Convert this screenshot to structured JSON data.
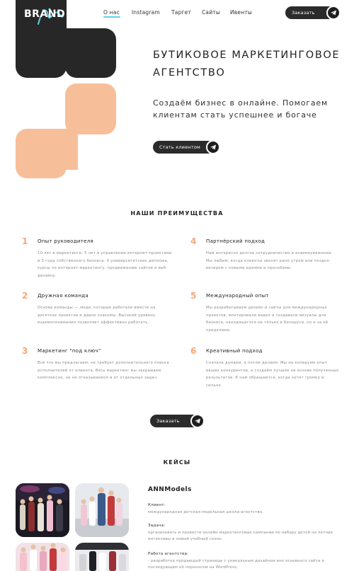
{
  "brand": {
    "logo_text": "BRAND"
  },
  "nav": {
    "items": [
      "О нас",
      "Instagram",
      "Таргет",
      "Сайты",
      "Ивенты"
    ],
    "active_index": 0
  },
  "header": {
    "order_button": "Заказать"
  },
  "hero": {
    "title": "БУТИКОВОЕ МАРКЕТИНГОВОЕ АГЕНТСТВО",
    "subtitle": "Создаём бизнес в онлайне. Помогаем клиентам стать успешнее и богаче",
    "cta": "Стать клиентом"
  },
  "advantages": {
    "heading": "НАШИ ПРЕИМУЩЕСТВА",
    "items": [
      {
        "num": "1",
        "title": "Опыт руководителя",
        "text": "10 лет в маркетинге, 5 лет в управлении интернет-проектами и 3 года собственного бизнеса. 4 университетских диплома, курсы по интернет-маркетингу, продвижению сайтов и веб-дизайну."
      },
      {
        "num": "2",
        "title": "Дружная команда",
        "text": "Основа команды — люди, которые работали вместе на десятках проектов и давно знакомы. Высокий уровень взаимопонимания позволяет эффективно работать."
      },
      {
        "num": "3",
        "title": "Маркетинг \"под ключ\"",
        "text": "Всё что мы предлагаем, не требует дополнительного поиска исполнителей от клиента. Весь маркетинг мы закрываем комплексно, но не отказываемся и от отдельных задач."
      },
      {
        "num": "4",
        "title": "Партнёрский подход",
        "text": "Нам интересно долгое сотрудничество и взаимоуважение. Мы любим, когда клиенты звонят рано утром или поздно вечером с новыми идеями и просьбами."
      },
      {
        "num": "5",
        "title": "Международный опыт",
        "text": "Мы разрабатываем дизайн и сайты для международных проектов, монтировали видео и создавали визуалы для бизнеса, находящегося не только в Беларуси, но и за её пределами."
      },
      {
        "num": "6",
        "title": "Креативный подход",
        "text": "Сначала думаем, а потом делаем. Мы не копируем опыт ваших конкурентов, а создаём лучшее на основе полученных результатов. К нам обращаются, когда хотят громко и сильно."
      }
    ],
    "order_button": "Заказать"
  },
  "cases": {
    "heading": "КЕЙСЫ",
    "title": "ANNModels",
    "client_label": "Клиент:",
    "client_text": "международная детская модельная школа-агентство.",
    "task_label": "Задача:",
    "task_text": "организовать и провести онлайн маркетинговые кампании по набору детей на летние интенсивы и новый учебный сезон.",
    "work_label": "Работа агентства:",
    "work_text": "- разработка продающей страницы с уникальным дизайном вне основного сайта и последующим её переносом на WordPress;"
  },
  "colors": {
    "dark": "#272727",
    "peach": "#f7bf99",
    "accent_number": "#f4a77a",
    "nav_underline": "#5fd3e6"
  }
}
